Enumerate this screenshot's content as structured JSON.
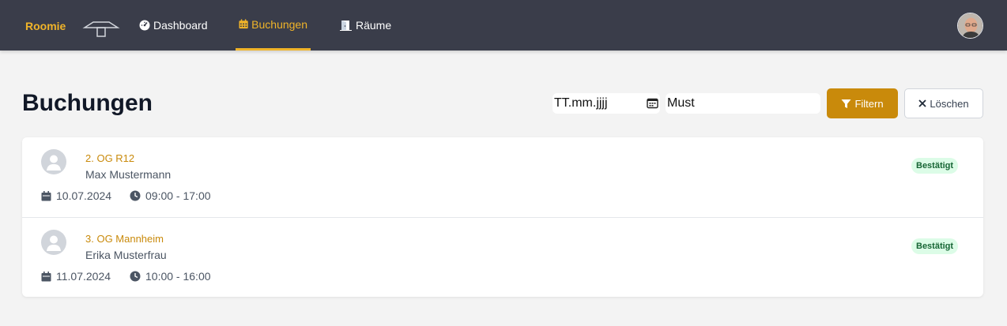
{
  "nav": {
    "brand": "Roomie",
    "items": [
      {
        "label": "Dashboard",
        "icon": "tachometer-icon"
      },
      {
        "label": "Buchungen",
        "icon": "calendar-icon",
        "active": true
      },
      {
        "label": "Räume",
        "icon": "door-icon"
      }
    ]
  },
  "page": {
    "title": "Buchungen"
  },
  "filters": {
    "date_placeholder": "TT.mm.jjjj",
    "search_value": "Must",
    "filter_label": "Filtern",
    "clear_label": "Löschen"
  },
  "bookings": [
    {
      "room": "2. OG R12",
      "person": "Max Mustermann",
      "date": "10.07.2024",
      "time": "09:00 - 17:00",
      "status": "Bestätigt"
    },
    {
      "room": "3. OG Mannheim",
      "person": "Erika Musterfrau",
      "date": "11.07.2024",
      "time": "10:00 - 16:00",
      "status": "Bestätigt"
    }
  ],
  "colors": {
    "nav_bg": "#3a3d4a",
    "accent": "#c98a0b",
    "brand": "#f0b429",
    "badge_bg": "#dcfce7",
    "badge_text": "#166534"
  }
}
